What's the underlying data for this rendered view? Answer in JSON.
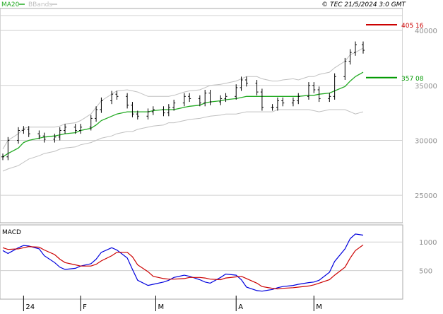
{
  "legend": {
    "ma20_label": "MA20",
    "bbands_label": "BBands",
    "ma20_color": "#22aa22",
    "bbands_color": "#c0c0c0"
  },
  "credit": "© TEC 21/5/2024 3:0 GMT",
  "price_colors": {
    "bar": "#000000",
    "bb": "#c0c0c0",
    "ma": "#22aa22",
    "grid": "#d0d0d0"
  },
  "chart_data": [
    {
      "type": "line",
      "title": "",
      "xlabel": "",
      "ylabel": "",
      "x": [
        "2024-01-02",
        "2024-01-04",
        "2024-01-08",
        "2024-01-10",
        "2024-01-12",
        "2024-01-16",
        "2024-01-18",
        "2024-01-22",
        "2024-01-24",
        "2024-01-26",
        "2024-01-30",
        "2024-02-01",
        "2024-02-05",
        "2024-02-07",
        "2024-02-09",
        "2024-02-13",
        "2024-02-15",
        "2024-02-19",
        "2024-02-21",
        "2024-02-23",
        "2024-02-27",
        "2024-02-29",
        "2024-03-04",
        "2024-03-06",
        "2024-03-08",
        "2024-03-12",
        "2024-03-14",
        "2024-03-18",
        "2024-03-20",
        "2024-03-22",
        "2024-03-26",
        "2024-03-28",
        "2024-04-01",
        "2024-04-03",
        "2024-04-05",
        "2024-04-09",
        "2024-04-11",
        "2024-04-15",
        "2024-04-17",
        "2024-04-19",
        "2024-04-23",
        "2024-04-25",
        "2024-04-29",
        "2024-05-01",
        "2024-05-03",
        "2024-05-07",
        "2024-05-09",
        "2024-05-13",
        "2024-05-15",
        "2024-05-17",
        "2024-05-20"
      ],
      "close": [
        285,
        300,
        309,
        310,
        306,
        304,
        301,
        303,
        309,
        312,
        309,
        312,
        320,
        328,
        336,
        342,
        340,
        332,
        324,
        322,
        326,
        328,
        325,
        330,
        334,
        340,
        338,
        334,
        343,
        335,
        338,
        340,
        348,
        355,
        352,
        344,
        330,
        330,
        336,
        334,
        336,
        340,
        350,
        346,
        338,
        340,
        358,
        372,
        380,
        387,
        382
      ],
      "ma20": [
        285,
        288,
        293,
        298,
        300,
        302,
        303,
        304,
        305,
        306,
        307,
        309,
        311,
        314,
        318,
        322,
        324,
        326,
        326,
        326,
        326,
        327,
        328,
        328,
        328,
        330,
        331,
        332,
        334,
        335,
        336,
        337,
        338,
        339,
        340,
        340,
        340,
        340,
        340,
        340,
        340,
        340,
        341,
        341,
        342,
        343,
        345,
        349,
        354,
        358,
        362
      ],
      "bb_upper": [
        292,
        300,
        306,
        311,
        312,
        312,
        312,
        312,
        313,
        315,
        316,
        318,
        324,
        330,
        336,
        342,
        345,
        346,
        345,
        344,
        340,
        340,
        340,
        340,
        341,
        344,
        345,
        346,
        348,
        350,
        351,
        352,
        354,
        356,
        358,
        358,
        356,
        354,
        354,
        355,
        356,
        355,
        358,
        358,
        360,
        362,
        366,
        372,
        378,
        380,
        384
      ],
      "bb_lower": [
        272,
        274,
        277,
        280,
        283,
        286,
        288,
        290,
        292,
        293,
        294,
        296,
        298,
        300,
        302,
        304,
        306,
        308,
        308,
        310,
        312,
        313,
        314,
        316,
        316,
        318,
        319,
        320,
        321,
        322,
        323,
        324,
        324,
        325,
        326,
        326,
        326,
        326,
        328,
        328,
        328,
        328,
        328,
        327,
        326,
        328,
        328,
        328,
        326,
        324,
        326
      ],
      "markers": [
        {
          "label": "405 16",
          "value": 405.16,
          "color": "#cc0000"
        },
        {
          "label": "357 08",
          "value": 357.08,
          "color": "#009900"
        }
      ],
      "y_ticks": [
        {
          "value": 250,
          "label": "25000"
        },
        {
          "value": 300,
          "label": "30000"
        },
        {
          "value": 350,
          "label": "35000"
        },
        {
          "value": 400,
          "label": "40000"
        }
      ],
      "ylim": [
        225,
        420
      ],
      "grid": true,
      "legend_position": "top-left"
    },
    {
      "type": "line",
      "title": "MACD",
      "x": [
        "2024-01-02",
        "2024-01-04",
        "2024-01-08",
        "2024-01-10",
        "2024-01-12",
        "2024-01-16",
        "2024-01-18",
        "2024-01-22",
        "2024-01-24",
        "2024-01-26",
        "2024-01-30",
        "2024-02-01",
        "2024-02-05",
        "2024-02-07",
        "2024-02-09",
        "2024-02-13",
        "2024-02-15",
        "2024-02-19",
        "2024-02-21",
        "2024-02-23",
        "2024-02-27",
        "2024-02-29",
        "2024-03-04",
        "2024-03-06",
        "2024-03-08",
        "2024-03-12",
        "2024-03-14",
        "2024-03-18",
        "2024-03-20",
        "2024-03-22",
        "2024-03-26",
        "2024-03-28",
        "2024-04-01",
        "2024-04-03",
        "2024-04-05",
        "2024-04-09",
        "2024-04-11",
        "2024-04-15",
        "2024-04-17",
        "2024-04-19",
        "2024-04-23",
        "2024-04-25",
        "2024-04-29",
        "2024-05-01",
        "2024-05-03",
        "2024-05-07",
        "2024-05-09",
        "2024-05-13",
        "2024-05-15",
        "2024-05-17",
        "2024-05-20"
      ],
      "series": [
        {
          "name": "",
          "color": "#0000dd",
          "values": [
            850,
            800,
            900,
            940,
            930,
            880,
            760,
            640,
            560,
            520,
            540,
            580,
            620,
            700,
            820,
            900,
            860,
            720,
            520,
            330,
            240,
            260,
            300,
            330,
            380,
            420,
            400,
            340,
            300,
            280,
            380,
            440,
            420,
            340,
            210,
            150,
            140,
            170,
            200,
            220,
            240,
            260,
            290,
            300,
            330,
            470,
            660,
            880,
            1060,
            1140,
            1120
          ]
        },
        {
          "name": "",
          "color": "#cc0000",
          "values": [
            900,
            870,
            880,
            900,
            920,
            910,
            860,
            780,
            700,
            640,
            600,
            580,
            580,
            610,
            670,
            760,
            820,
            820,
            740,
            600,
            480,
            400,
            360,
            350,
            350,
            360,
            380,
            380,
            370,
            350,
            340,
            370,
            390,
            400,
            360,
            280,
            220,
            190,
            180,
            190,
            200,
            210,
            230,
            250,
            280,
            340,
            420,
            560,
            720,
            850,
            950
          ]
        }
      ],
      "y_ticks": [
        {
          "value": 500,
          "label": "500"
        },
        {
          "value": 1000,
          "label": "1000"
        }
      ],
      "ylim": [
        0,
        1300
      ],
      "grid": true
    }
  ],
  "x_axis": {
    "month_labels": [
      {
        "date": "2024-01-10",
        "label": "24"
      },
      {
        "date": "2024-02-01",
        "label": "F"
      },
      {
        "date": "2024-03-01",
        "label": "M"
      },
      {
        "date": "2024-04-01",
        "label": "A"
      },
      {
        "date": "2024-05-01",
        "label": "M"
      }
    ]
  }
}
